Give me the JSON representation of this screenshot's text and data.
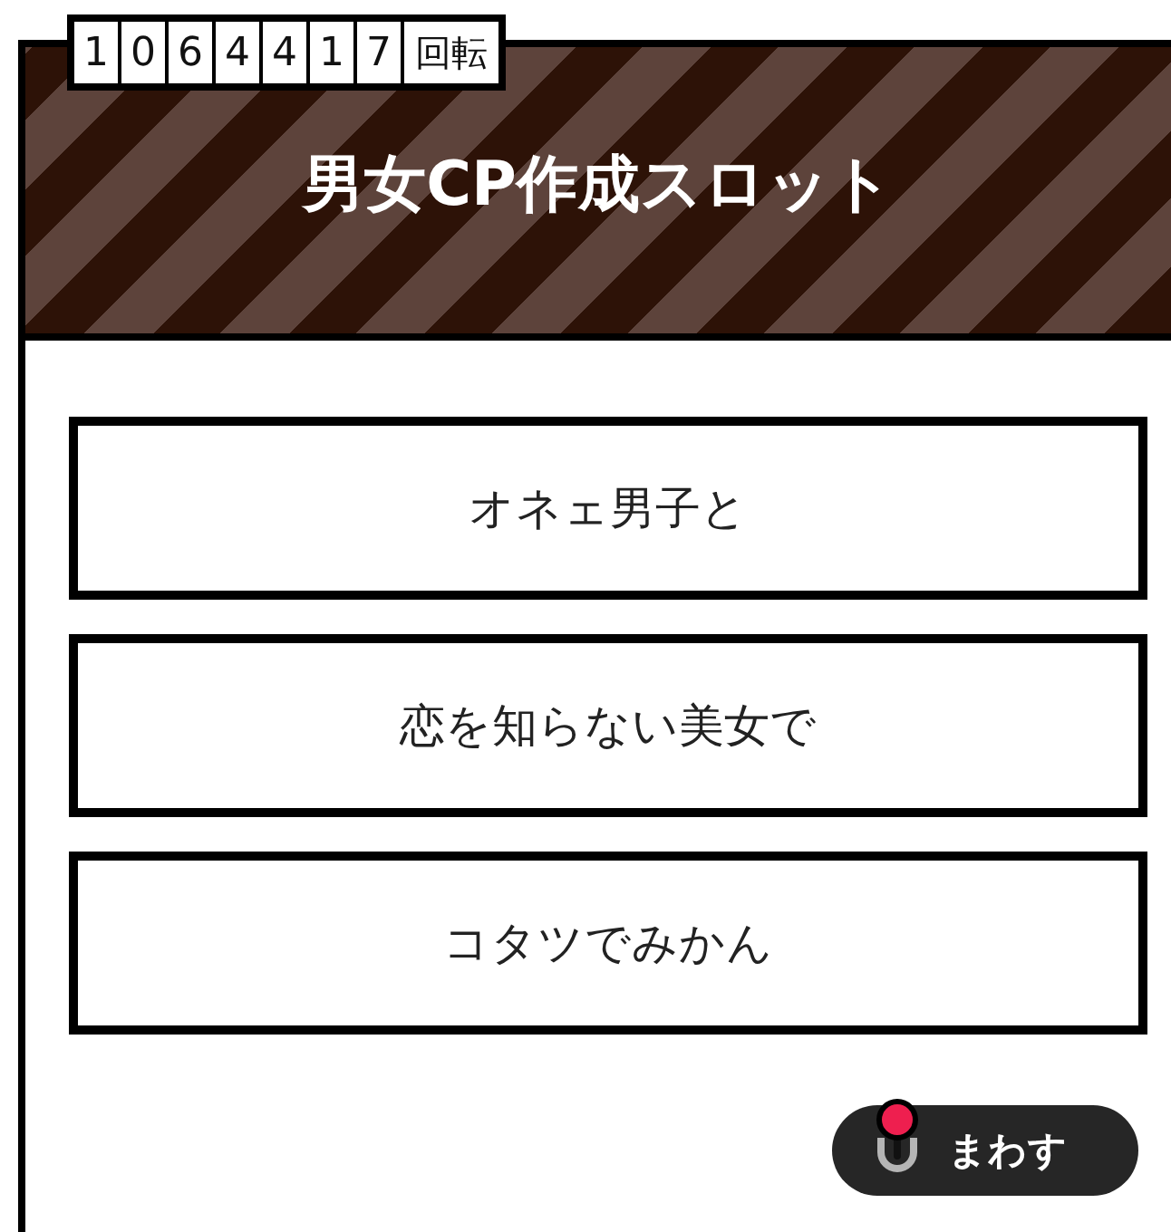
{
  "counter": {
    "digits": [
      "1",
      "0",
      "6",
      "4",
      "4",
      "1",
      "7"
    ],
    "unit": "回転"
  },
  "title": "男女CP作成スロット",
  "reels": [
    "オネェ男子と",
    "恋を知らない美女で",
    "コタツでみかん"
  ],
  "spin_button": {
    "label": "まわす"
  }
}
